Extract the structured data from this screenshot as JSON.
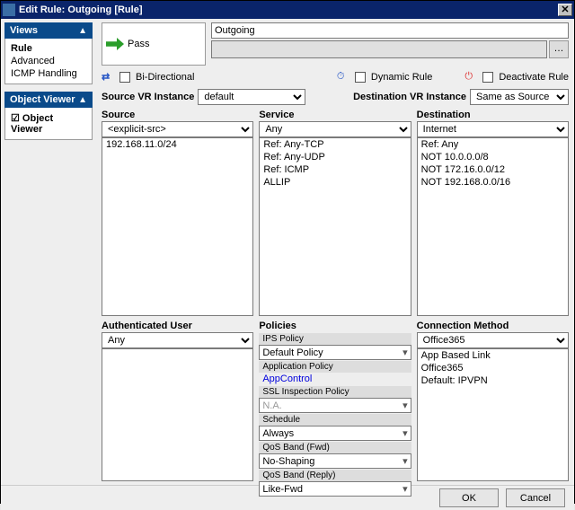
{
  "window": {
    "title": "Edit Rule: Outgoing [Rule]"
  },
  "views": {
    "title": "Views",
    "items": [
      "Rule",
      "Advanced",
      "ICMP Handling"
    ]
  },
  "objv": {
    "title": "Object Viewer",
    "item": "Object Viewer"
  },
  "action": {
    "label": "Pass"
  },
  "name": {
    "value": "Outgoing"
  },
  "chk": {
    "bidi": "Bi-Directional",
    "dyn": "Dynamic Rule",
    "deact": "Deactivate Rule"
  },
  "vr": {
    "src_lbl": "Source VR Instance",
    "src_val": "default",
    "dst_lbl": "Destination VR Instance",
    "dst_val": "Same as Source"
  },
  "src": {
    "hdr": "Source",
    "sel": "<explicit-src>",
    "items": [
      "192.168.11.0/24"
    ]
  },
  "svc": {
    "hdr": "Service",
    "sel": "Any",
    "items": [
      "Ref: Any-TCP",
      "Ref: Any-UDP",
      "Ref: ICMP",
      "ALLIP"
    ]
  },
  "dst": {
    "hdr": "Destination",
    "sel": "Internet",
    "items": [
      "Ref: Any",
      "NOT 10.0.0.0/8",
      "NOT 172.16.0.0/12",
      "NOT 192.168.0.0/16"
    ]
  },
  "auth": {
    "hdr": "Authenticated User",
    "sel": "Any"
  },
  "pol": {
    "hdr": "Policies",
    "ips_lbl": "IPS Policy",
    "ips": "Default Policy",
    "app_lbl": "Application Policy",
    "app": "AppControl",
    "ssl_lbl": "SSL Inspection Policy",
    "ssl": "N.A.",
    "sched_lbl": "Schedule",
    "sched": "Always",
    "qosf_lbl": "QoS Band (Fwd)",
    "qosf": "No-Shaping",
    "qosr_lbl": "QoS Band (Reply)",
    "qosr": "Like-Fwd"
  },
  "conn": {
    "hdr": "Connection Method",
    "sel": "Office365",
    "items": [
      "App Based Link",
      "Office365",
      "Default: IPVPN"
    ]
  },
  "btns": {
    "ok": "OK",
    "cancel": "Cancel"
  }
}
